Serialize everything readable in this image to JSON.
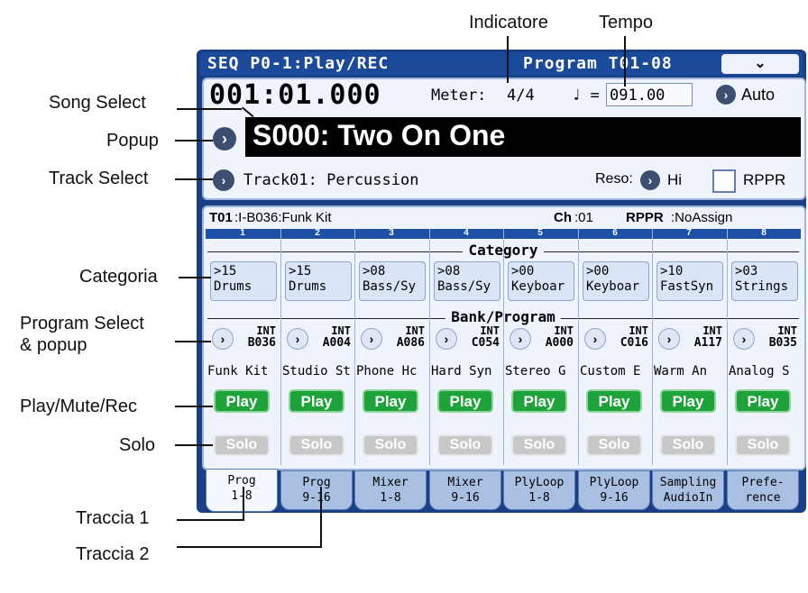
{
  "annotations": {
    "indicatore": "Indicatore",
    "tempo": "Tempo",
    "song_select": "Song Select",
    "popup": "Popup",
    "track_select": "Track Select",
    "categoria": "Categoria",
    "program_select_1": "Program Select",
    "program_select_2": "& popup",
    "play_mute_rec": "Play/Mute/Rec",
    "solo": "Solo",
    "traccia1": "Traccia 1",
    "traccia2": "Traccia 2"
  },
  "header": {
    "mode": "SEQ P0-1:Play/REC",
    "view": "Program T01-08",
    "menu_icon": "chevron-down-icon"
  },
  "transport": {
    "position": "001:01.000",
    "meter_label": "Meter:",
    "meter_value": "4/4",
    "tempo_note": "♩ =",
    "tempo_value": "091.00",
    "tempo_mode": "Auto"
  },
  "song": {
    "name": "S000: Two On One"
  },
  "track": {
    "name": "Track01: Percussion",
    "reso_label": "Reso:",
    "reso_value": "Hi",
    "rppr_label": "RPPR"
  },
  "info_line": {
    "track_id": "T01",
    "program": ":I-B036:Funk Kit",
    "ch_label": "Ch",
    "ch_value": ":01",
    "rppr_label": "RPPR",
    "rppr_value": ":NoAssign"
  },
  "sections": {
    "category": "Category",
    "bank_program": "Bank/Program"
  },
  "columns": [
    {
      "num": "1",
      "cat_id": ">15",
      "cat_name": "Drums",
      "bank": "INT",
      "prog_no": "B036",
      "prog_name": "Funk Kit",
      "play": "Play",
      "solo": "Solo"
    },
    {
      "num": "2",
      "cat_id": ">15",
      "cat_name": "Drums",
      "bank": "INT",
      "prog_no": "A004",
      "prog_name": "Studio St",
      "play": "Play",
      "solo": "Solo"
    },
    {
      "num": "3",
      "cat_id": ">08",
      "cat_name": "Bass/Sy",
      "bank": "INT",
      "prog_no": "A086",
      "prog_name": "Phone Hc",
      "play": "Play",
      "solo": "Solo"
    },
    {
      "num": "4",
      "cat_id": ">08",
      "cat_name": "Bass/Sy",
      "bank": "INT",
      "prog_no": "C054",
      "prog_name": "Hard Syn",
      "play": "Play",
      "solo": "Solo"
    },
    {
      "num": "5",
      "cat_id": ">00",
      "cat_name": "Keyboar",
      "bank": "INT",
      "prog_no": "A000",
      "prog_name": "Stereo G",
      "play": "Play",
      "solo": "Solo"
    },
    {
      "num": "6",
      "cat_id": ">00",
      "cat_name": "Keyboar",
      "bank": "INT",
      "prog_no": "C016",
      "prog_name": "Custom E",
      "play": "Play",
      "solo": "Solo"
    },
    {
      "num": "7",
      "cat_id": ">10",
      "cat_name": "FastSyn",
      "bank": "INT",
      "prog_no": "A117",
      "prog_name": "Warm An",
      "play": "Play",
      "solo": "Solo"
    },
    {
      "num": "8",
      "cat_id": ">03",
      "cat_name": "Strings",
      "bank": "INT",
      "prog_no": "B035",
      "prog_name": "Analog S",
      "play": "Play",
      "solo": "Solo"
    }
  ],
  "tabs": [
    {
      "line1": "Prog",
      "line2": "1-8"
    },
    {
      "line1": "Prog",
      "line2": "9-16"
    },
    {
      "line1": "Mixer",
      "line2": "1-8"
    },
    {
      "line1": "Mixer",
      "line2": "9-16"
    },
    {
      "line1": "PlyLoop",
      "line2": "1-8"
    },
    {
      "line1": "PlyLoop",
      "line2": "9-16"
    },
    {
      "line1": "Sampling",
      "line2": "AudioIn"
    },
    {
      "line1": "Prefe-",
      "line2": "rence"
    }
  ],
  "colors": {
    "title_bar": "#1c4a9a",
    "play_green": "#1ea33a",
    "panel": "#eef3fc"
  }
}
